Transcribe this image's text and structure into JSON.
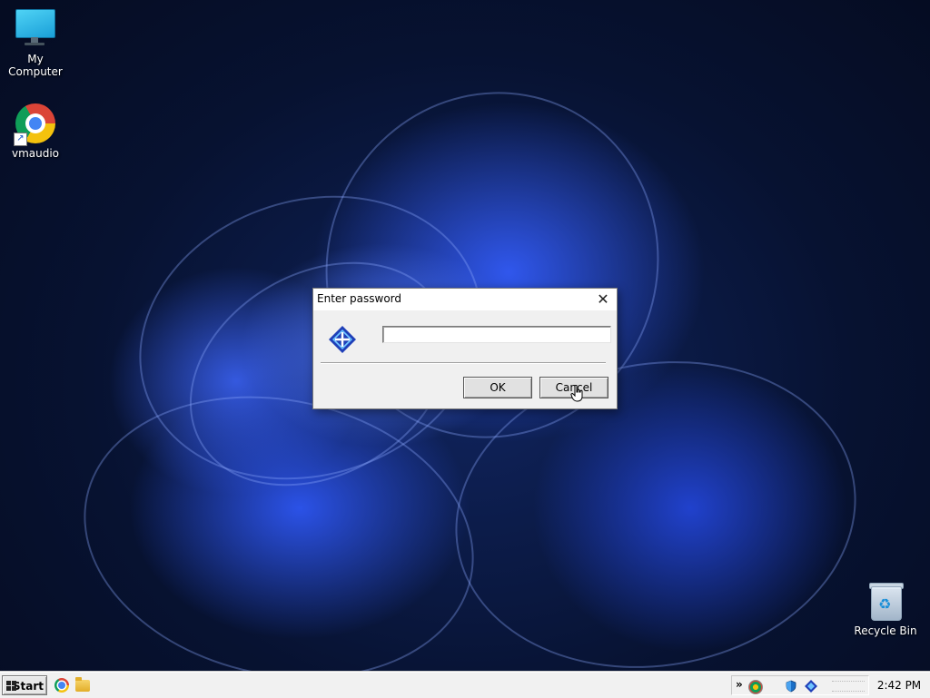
{
  "desktop": {
    "icons": [
      {
        "label": "My Computer",
        "icon": "monitor-icon"
      },
      {
        "label": "vmaudio",
        "icon": "chrome-icon",
        "shortcut": true
      },
      {
        "label": "Recycle Bin",
        "icon": "recycle-bin-icon"
      }
    ]
  },
  "dialog": {
    "title": "Enter password",
    "close_glyph": "✕",
    "password_value": "",
    "ok_label": "OK",
    "cancel_label": "Cancel",
    "icon": "app-logo-icon"
  },
  "taskbar": {
    "start_label": "Start",
    "pinned": [
      {
        "icon": "chrome-icon"
      },
      {
        "icon": "folder-icon"
      }
    ],
    "tray": {
      "expand_glyph": "»",
      "icons": [
        "network-icon",
        "shield-icon",
        "app-tray-icon"
      ]
    },
    "clock": "2:42 PM"
  },
  "colors": {
    "desktop_bg": "#071231",
    "bloom_blue": "#2f5bf0",
    "dialog_bg": "#f0f0f0",
    "taskbar_bg": "#f1f1f1"
  }
}
